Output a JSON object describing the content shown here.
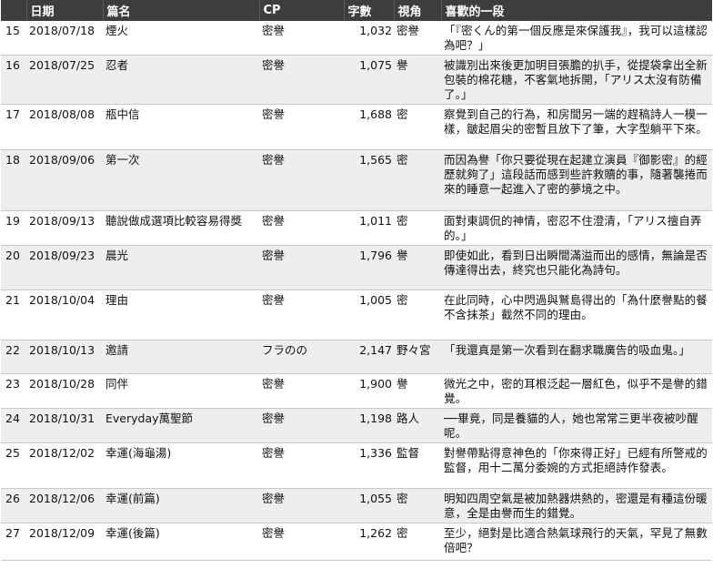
{
  "headers": [
    "",
    "日期",
    "篇名",
    "CP",
    "字數",
    "視角",
    "喜歡的一段"
  ],
  "rows": [
    {
      "no": "15",
      "date": "2018/07/18",
      "title": "煙火",
      "cp": "密譽",
      "words": "1,032",
      "view": "密譽",
      "quote": "「『密くん的第一個反應是來保護我』，我可以這樣認為吧？」",
      "h": 35
    },
    {
      "no": "16",
      "date": "2018/07/25",
      "title": "忍者",
      "cp": "密譽",
      "words": "1,075",
      "view": "譽",
      "quote": "被識別出來後更加明目張膽的扒手，從提袋拿出全新包裝的棉花糖，不客氣地拆開，「アリス太沒有防備了。」",
      "h": 50
    },
    {
      "no": "17",
      "date": "2018/08/08",
      "title": "瓶中信",
      "cp": "密譽",
      "words": "1,688",
      "view": "密",
      "quote": "察覺到自己的行為，和房間另一端的趕稿詩人一模一樣，皺起眉尖的密暫且放下了筆，大字型躺平下來。",
      "h": 50
    },
    {
      "no": "18",
      "date": "2018/09/06",
      "title": "第一次",
      "cp": "密譽",
      "words": "1,565",
      "view": "密",
      "quote": "而因為譽「你只要從現在起建立演員『御影密』的經歷就夠了」這段話而感到些許救贖的事，隨著襲捲而來的睡意一起進入了密的夢境之中。",
      "h": 67
    },
    {
      "no": "19",
      "date": "2018/09/13",
      "title": "聽說做成選項比較容易得獎",
      "cp": "密譽",
      "words": "1,011",
      "view": "密",
      "quote": "面對東調侃的神情，密忍不住澄清，「アリス擅自弄的。」",
      "h": 35
    },
    {
      "no": "20",
      "date": "2018/09/23",
      "title": "晨光",
      "cp": "密譽",
      "words": "1,796",
      "view": "譽",
      "quote": "即使如此，看到日出瞬間滿溢而出的感情，無論是否傳達得出去，終究也只能化為詩句。",
      "h": 49
    },
    {
      "no": "21",
      "date": "2018/10/04",
      "title": "理由",
      "cp": "密譽",
      "words": "1,005",
      "view": "密",
      "quote": "在此同時，心中閃過與鷲島得出的「為什麼譽點的餐不含抹茶」截然不同的理由。",
      "h": 55
    },
    {
      "no": "22",
      "date": "2018/10/13",
      "title": "邀請",
      "cp": "フラのの",
      "words": "2,147",
      "view": "野々宮",
      "quote": "「我還真是第一次看到在翻求職廣告的吸血鬼。」",
      "h": 37
    },
    {
      "no": "23",
      "date": "2018/10/28",
      "title": "同伴",
      "cp": "密譽",
      "words": "1,900",
      "view": "譽",
      "quote": "微光之中，密的耳根泛起一層紅色，似乎不是譽的錯覺。",
      "h": 34
    },
    {
      "no": "24",
      "date": "2018/10/31",
      "title": "Everyday萬聖節",
      "cp": "密譽",
      "words": "1,198",
      "view": "路人",
      "quote": "──畢竟，同是養貓的人，她也常常三更半夜被吵醒呢。",
      "h": 35
    },
    {
      "no": "25",
      "date": "2018/12/02",
      "title": "幸運(海龜湯)",
      "cp": "密譽",
      "words": "1,336",
      "view": "監督",
      "quote": "對譽帶點得意神色的「你來得正好」已經有所警戒的監督，用十二萬分委婉的方式拒絕詩作發表。",
      "h": 50
    },
    {
      "no": "26",
      "date": "2018/12/06",
      "title": "幸運(前篇)",
      "cp": "密譽",
      "words": "1,055",
      "view": "密",
      "quote": "明知四周空氣是被加熱器烘熱的，密還是有種這份暖意，全是由譽而生的錯覺。",
      "h": 37
    },
    {
      "no": "27",
      "date": "2018/12/09",
      "title": "幸運(後篇)",
      "cp": "密譽",
      "words": "1,262",
      "view": "密",
      "quote": "至少，絕對是比適合熱氣球飛行的天氣，罕見了無數倍吧？",
      "h": 41
    }
  ]
}
